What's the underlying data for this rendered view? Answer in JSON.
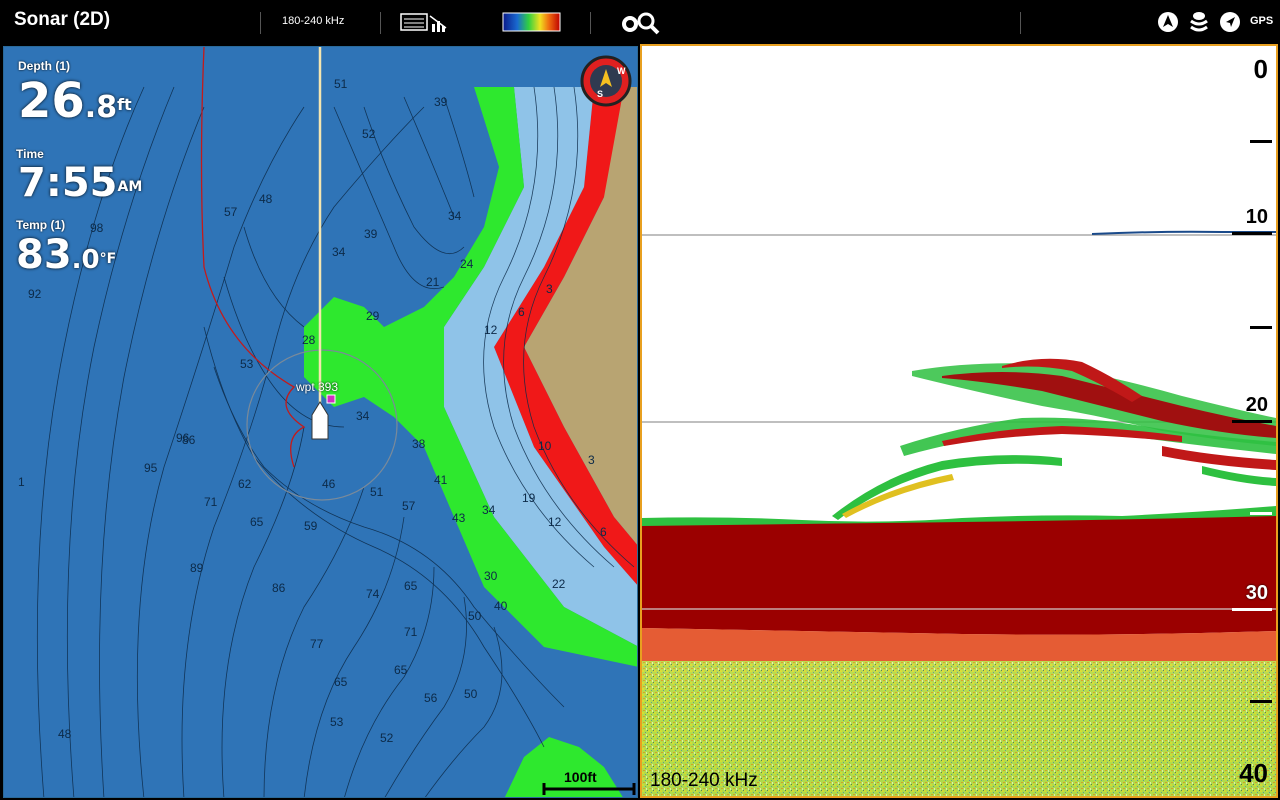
{
  "topbar": {
    "title": "Sonar (2D)",
    "frequency": "180-240 kHz",
    "icons": [
      "sonar-view-icon",
      "color-palette-icon",
      "settings-search-icon",
      "nav-arrow-icon",
      "layers-icon",
      "heading-icon",
      "gps-icon"
    ],
    "gps_label": "GPS"
  },
  "map": {
    "depth_label": "Depth (1)",
    "depth_value": "26",
    "depth_decimal": ".8",
    "depth_unit": "ft",
    "time_label": "Time",
    "time_value": "7:55",
    "time_suffix": "AM",
    "temp_label": "Temp (1)",
    "temp_value": "83",
    "temp_decimal": ".0",
    "temp_unit": "°F",
    "waypoint_label": "wpt 393",
    "scale_label": "100ft",
    "contour_labels": [
      "51",
      "52",
      "39",
      "48",
      "57",
      "98",
      "92",
      "39",
      "34",
      "34",
      "24",
      "34",
      "29",
      "21",
      "12",
      "6",
      "3",
      "28",
      "53",
      "96",
      "95",
      "86",
      "71",
      "62",
      "65",
      "59",
      "46",
      "51",
      "57",
      "43",
      "38",
      "41",
      "34",
      "30",
      "40",
      "50",
      "65",
      "74",
      "71",
      "65",
      "77",
      "86",
      "89",
      "65",
      "53",
      "52",
      "56",
      "50",
      "22",
      "19",
      "12",
      "10",
      "3",
      "6",
      "1",
      "48"
    ],
    "compass_letters": [
      "W",
      "S"
    ]
  },
  "sonar": {
    "scale": [
      "0",
      "10",
      "20",
      "30",
      "40"
    ],
    "frequency_label": "180-240 kHz"
  },
  "colors": {
    "deep_water": "#2f74b7",
    "shallow_green": "#2ee82e",
    "shallow_blue": "#8fc3e8",
    "shore_red": "#f01818",
    "land": "#b8a472",
    "sonar_bottom": "#9b0000",
    "accent_border": "#e8a020"
  }
}
